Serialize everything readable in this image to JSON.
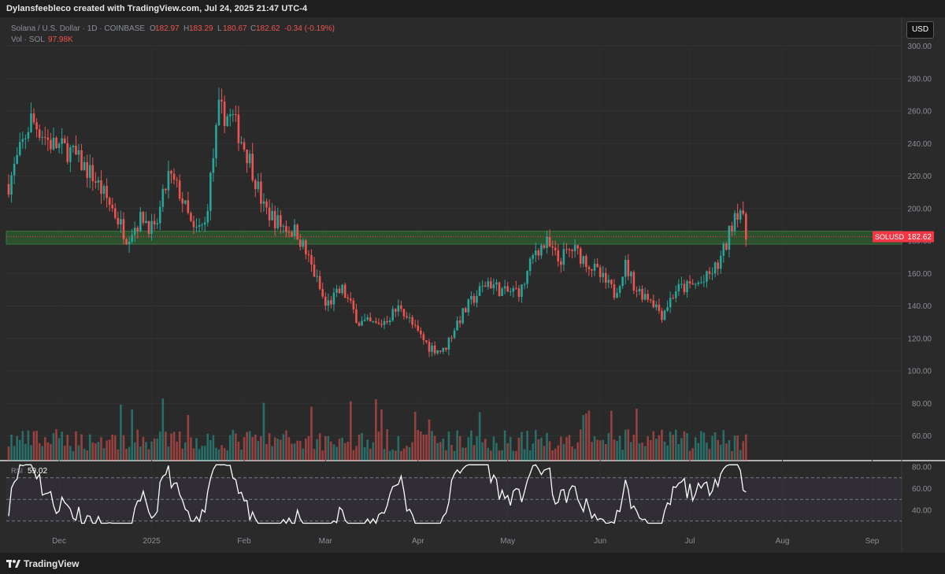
{
  "caption": "Dylansfeebleco created with TradingView.com, Jul 24, 2025 21:47 UTC-4",
  "brand": "TradingView",
  "currency_button": "USD",
  "legend": {
    "symbol_line": "Solana / U.S. Dollar · 1D · COINBASE",
    "o_label": "O",
    "o_value": "182.97",
    "h_label": "H",
    "h_value": "183.29",
    "l_label": "L",
    "l_value": "180.67",
    "c_label": "C",
    "c_value": "182.62",
    "change": "-0.34 (-0.19%)",
    "vol_label": "Vol · SOL",
    "vol_value": "97.98K",
    "rsi_label": "RSI",
    "rsi_value": "59.02"
  },
  "colors": {
    "up": "#26a69a",
    "down": "#ef5350",
    "zone": "#2e7d32",
    "tag": "#f23645",
    "rsi_line": "#ffffff"
  },
  "chart_data": [
    {
      "type": "candlestick",
      "symbol": "SOLUSD",
      "last_price": 182.62,
      "price_tag": "SOLUSD",
      "ylim": [
        70,
        305
      ],
      "yticks": [
        "300.00",
        "280.00",
        "260.00",
        "240.00",
        "220.00",
        "200.00",
        "180.00",
        "160.00",
        "140.00",
        "120.00",
        "100.00",
        "80.00",
        "60.00"
      ],
      "xticks": [
        "Dec",
        "2025",
        "Feb",
        "Mar",
        "Apr",
        "May",
        "Jun",
        "Jul",
        "Aug",
        "Sep"
      ],
      "support_zone": [
        178,
        186
      ],
      "waypoints": [
        {
          "day": 0,
          "price": 215
        },
        {
          "day": 8,
          "price": 255
        },
        {
          "day": 15,
          "price": 240
        },
        {
          "day": 22,
          "price": 235
        },
        {
          "day": 30,
          "price": 220
        },
        {
          "day": 37,
          "price": 200
        },
        {
          "day": 42,
          "price": 183
        },
        {
          "day": 48,
          "price": 195
        },
        {
          "day": 52,
          "price": 185
        },
        {
          "day": 57,
          "price": 220
        },
        {
          "day": 61,
          "price": 210
        },
        {
          "day": 66,
          "price": 185
        },
        {
          "day": 70,
          "price": 190
        },
        {
          "day": 75,
          "price": 260
        },
        {
          "day": 80,
          "price": 255
        },
        {
          "day": 86,
          "price": 230
        },
        {
          "day": 91,
          "price": 200
        },
        {
          "day": 97,
          "price": 190
        },
        {
          "day": 103,
          "price": 185
        },
        {
          "day": 109,
          "price": 160
        },
        {
          "day": 113,
          "price": 140
        },
        {
          "day": 119,
          "price": 150
        },
        {
          "day": 125,
          "price": 130
        },
        {
          "day": 132,
          "price": 128
        },
        {
          "day": 140,
          "price": 140
        },
        {
          "day": 145,
          "price": 125
        },
        {
          "day": 150,
          "price": 115
        },
        {
          "day": 155,
          "price": 112
        },
        {
          "day": 160,
          "price": 130
        },
        {
          "day": 166,
          "price": 145
        },
        {
          "day": 171,
          "price": 155
        },
        {
          "day": 177,
          "price": 148
        },
        {
          "day": 183,
          "price": 150
        },
        {
          "day": 188,
          "price": 175
        },
        {
          "day": 192,
          "price": 178
        },
        {
          "day": 196,
          "price": 168
        },
        {
          "day": 201,
          "price": 175
        },
        {
          "day": 206,
          "price": 168
        },
        {
          "day": 211,
          "price": 158
        },
        {
          "day": 216,
          "price": 148
        },
        {
          "day": 220,
          "price": 165
        },
        {
          "day": 224,
          "price": 150
        },
        {
          "day": 229,
          "price": 145
        },
        {
          "day": 233,
          "price": 135
        },
        {
          "day": 238,
          "price": 150
        },
        {
          "day": 243,
          "price": 152
        },
        {
          "day": 248,
          "price": 155
        },
        {
          "day": 253,
          "price": 165
        },
        {
          "day": 256,
          "price": 178
        },
        {
          "day": 259,
          "price": 198
        },
        {
          "day": 261,
          "price": 200
        },
        {
          "day": 263,
          "price": 182
        }
      ]
    },
    {
      "type": "bar",
      "name": "Vol · SOL",
      "last_value": "97.98K"
    },
    {
      "type": "line",
      "name": "RSI",
      "last_value": 59.02,
      "ylim": [
        25,
        85
      ],
      "yticks": [
        "80.00",
        "60.00",
        "40.00"
      ],
      "bands": [
        70,
        50,
        30
      ]
    }
  ]
}
